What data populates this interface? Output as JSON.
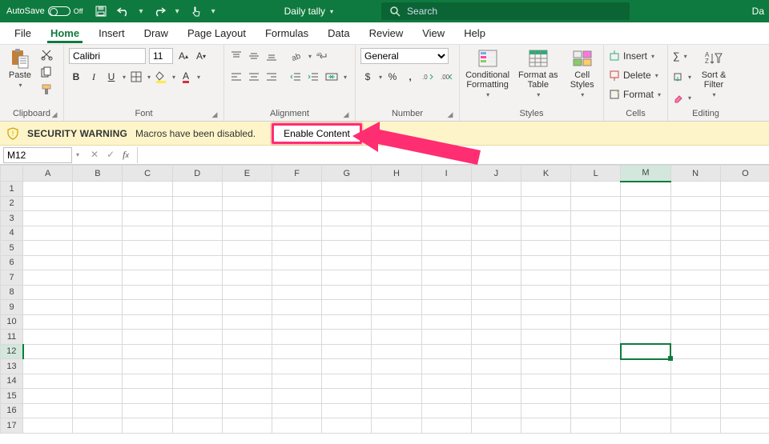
{
  "titlebar": {
    "autosave_label": "AutoSave",
    "autosave_state": "Off",
    "doc_name": "Daily tally",
    "search_placeholder": "Search",
    "right_text": "Da"
  },
  "tabs": [
    "File",
    "Home",
    "Insert",
    "Draw",
    "Page Layout",
    "Formulas",
    "Data",
    "Review",
    "View",
    "Help"
  ],
  "active_tab": "Home",
  "ribbon": {
    "clipboard": {
      "paste": "Paste",
      "label": "Clipboard"
    },
    "font": {
      "name": "Calibri",
      "size": "11",
      "bold": "B",
      "italic": "I",
      "underline": "U",
      "label": "Font"
    },
    "alignment": {
      "label": "Alignment"
    },
    "number": {
      "format": "General",
      "label": "Number"
    },
    "styles": {
      "cond": "Conditional\nFormatting",
      "table": "Format as\nTable",
      "cell": "Cell\nStyles",
      "label": "Styles"
    },
    "cells": {
      "insert": "Insert",
      "delete": "Delete",
      "format": "Format",
      "label": "Cells"
    },
    "editing": {
      "sort": "Sort &\nFilter",
      "label": "Editing"
    }
  },
  "security": {
    "title": "SECURITY WARNING",
    "message": "Macros have been disabled.",
    "button": "Enable Content"
  },
  "namebox": "M12",
  "columns": [
    "A",
    "B",
    "C",
    "D",
    "E",
    "F",
    "G",
    "H",
    "I",
    "J",
    "K",
    "L",
    "M",
    "N",
    "O"
  ],
  "rows": [
    "1",
    "2",
    "3",
    "4",
    "5",
    "6",
    "7",
    "8",
    "9",
    "10",
    "11",
    "12",
    "13",
    "14",
    "15",
    "16",
    "17"
  ],
  "active_col": "M",
  "active_row": "12"
}
